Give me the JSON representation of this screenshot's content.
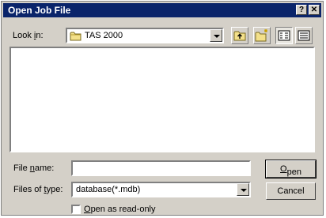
{
  "window": {
    "title": "Open Job File",
    "help_label": "?",
    "close_label": "✕"
  },
  "look_in": {
    "label_pre": "Look ",
    "label_u": "i",
    "label_post": "n:",
    "value": "TAS 2000",
    "icon": "folder-icon"
  },
  "toolbar": {
    "buttons": [
      "up-one-level-icon",
      "create-new-folder-icon",
      "list-view-icon",
      "details-view-icon"
    ]
  },
  "file_name": {
    "label_pre": "File ",
    "label_u": "n",
    "label_post": "ame:",
    "value": ""
  },
  "file_type": {
    "label_pre": "Files of ",
    "label_u": "t",
    "label_post": "ype:",
    "value": "database(*.mdb)"
  },
  "buttons": {
    "open_u": "O",
    "open_post": "pen",
    "cancel": "Cancel"
  },
  "read_only": {
    "label_u": "O",
    "label_post": "pen as read-only",
    "checked": false
  }
}
